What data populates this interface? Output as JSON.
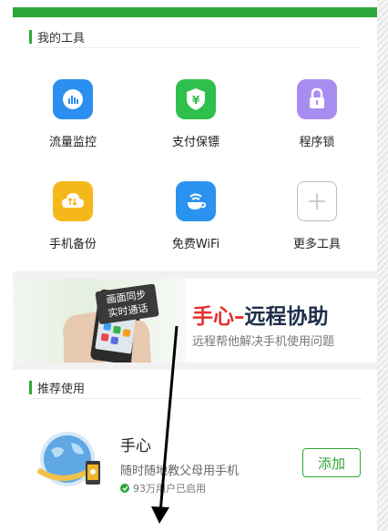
{
  "my_tools": {
    "title": "我的工具",
    "items": [
      {
        "label": "流量监控",
        "icon": "traffic-monitor-icon",
        "color": "#2a8ff0"
      },
      {
        "label": "支付保镖",
        "icon": "payment-shield-icon",
        "color": "#2fbf4d"
      },
      {
        "label": "程序锁",
        "icon": "app-lock-icon",
        "color": "#a88df0"
      },
      {
        "label": "手机备份",
        "icon": "cloud-backup-icon",
        "color": "#f5b81b"
      },
      {
        "label": "免费WiFi",
        "icon": "wifi-cup-icon",
        "color": "#2a93ef"
      },
      {
        "label": "更多工具",
        "icon": "plus-icon",
        "color": "#bdbdbd"
      }
    ]
  },
  "banner": {
    "phone_text_line1": "画面同步",
    "phone_text_line2": "实时通话",
    "title_red": "手心",
    "title_dash": "–",
    "title_blue": "远程协助",
    "subtitle": "远程帮他解决手机使用问题"
  },
  "recommend": {
    "title": "推荐使用",
    "app": {
      "name": "手心",
      "description": "随时随地教父母用手机",
      "users": "93万用户已启用",
      "button": "添加"
    }
  },
  "colors": {
    "accent_green": "#2da83a",
    "banner_red": "#e5322d",
    "banner_dark": "#1e2f4a"
  }
}
